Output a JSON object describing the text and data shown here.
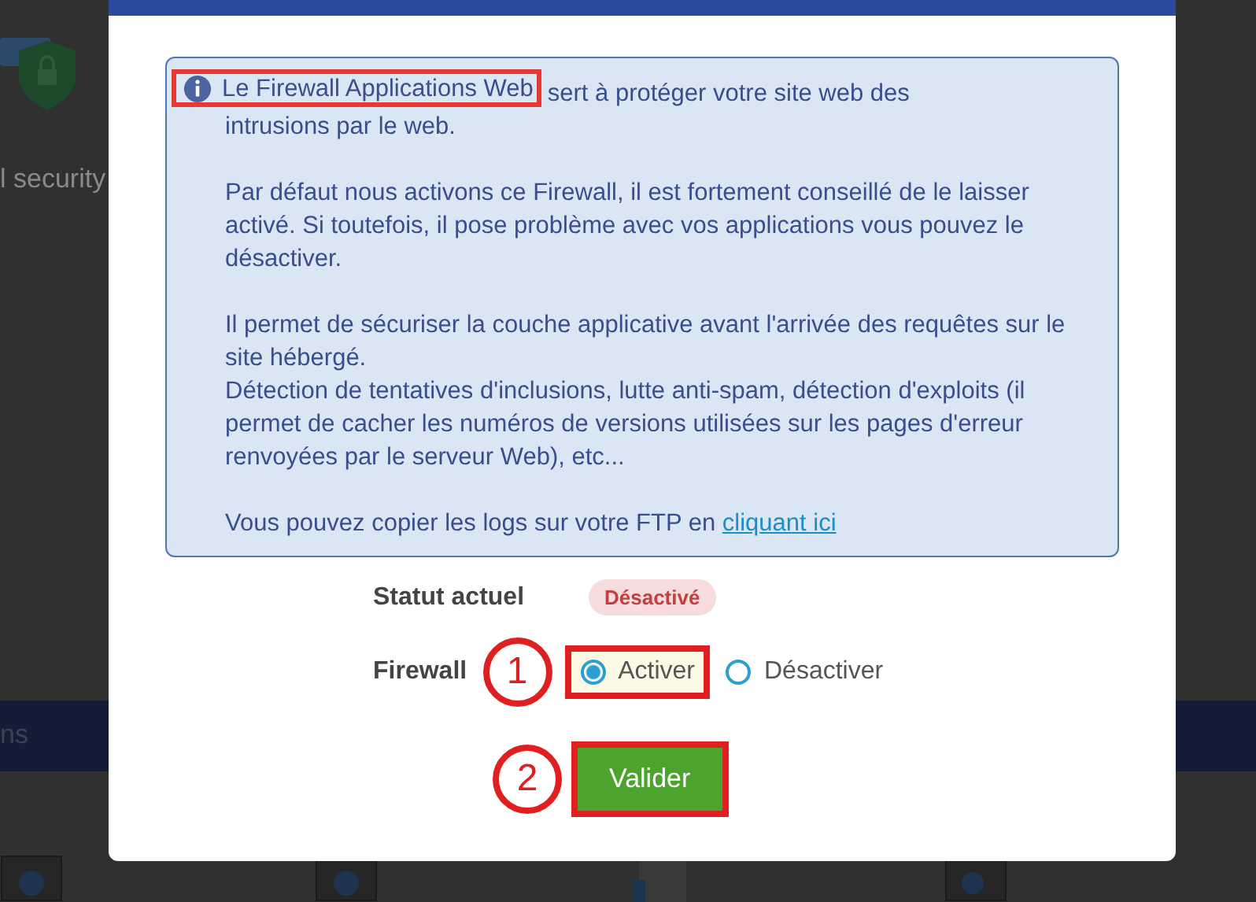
{
  "background": {
    "sidebar_text": "l security",
    "banner_text": "ns"
  },
  "dialog": {
    "info": {
      "highlight": "Le Firewall Applications Web",
      "lead_rest": [
        "sert à protéger votre site web des",
        "intrusions par le web."
      ],
      "paragraphs": [
        [
          "Par défaut nous activons ce Firewall, il est fortement conseillé de le laisser activé. Si toutefois, il pose problème avec vos applications vous pouvez le désactiver."
        ],
        [
          "Il permet de sécuriser la couche applicative avant l'arrivée des requêtes sur le site hébergé.",
          "Détection de tentatives d'inclusions, lutte anti-spam, détection d'exploits (il permet de cacher les numéros de versions utilisées sur les pages d'erreur renvoyées par le serveur Web), etc..."
        ]
      ],
      "footer": {
        "text": "Vous pouvez copier les logs sur votre FTP en ",
        "link": "cliquant ici"
      }
    },
    "status": {
      "label": "Statut actuel",
      "badge": "Désactivé"
    },
    "firewall": {
      "label": "Firewall",
      "step": "1",
      "options": [
        {
          "label": "Activer",
          "selected": true,
          "highlighted": true
        },
        {
          "label": "Désactiver",
          "selected": false,
          "highlighted": false
        }
      ]
    },
    "submit": {
      "step": "2",
      "label": "Valider"
    }
  }
}
